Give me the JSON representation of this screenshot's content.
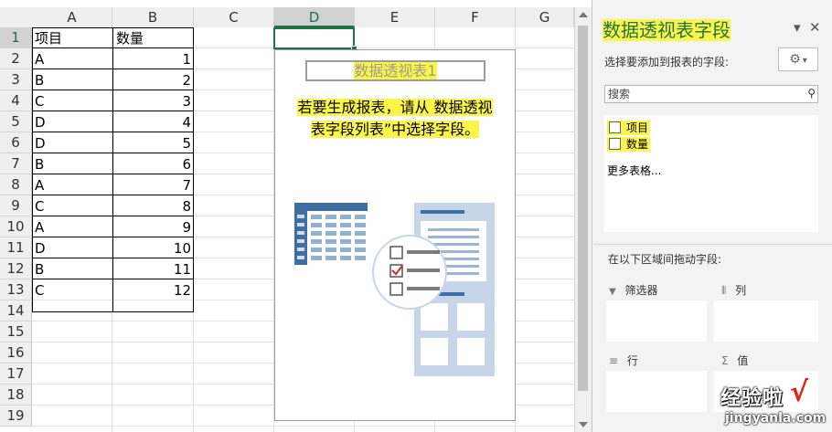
{
  "columns": [
    "A",
    "B",
    "C",
    "D",
    "E",
    "F",
    "G"
  ],
  "rows": [
    "1",
    "2",
    "3",
    "4",
    "5",
    "6",
    "7",
    "8",
    "9",
    "10",
    "11",
    "12",
    "13",
    "14",
    "15",
    "16",
    "17",
    "18",
    "19"
  ],
  "table": {
    "headers": [
      "项目",
      "数量"
    ],
    "data": [
      [
        "A",
        "1"
      ],
      [
        "B",
        "2"
      ],
      [
        "C",
        "3"
      ],
      [
        "D",
        "4"
      ],
      [
        "D",
        "5"
      ],
      [
        "B",
        "6"
      ],
      [
        "A",
        "7"
      ],
      [
        "C",
        "8"
      ],
      [
        "A",
        "9"
      ],
      [
        "D",
        "10"
      ],
      [
        "B",
        "11"
      ],
      [
        "C",
        "12"
      ]
    ]
  },
  "pivot_placeholder": {
    "title": "数据透视表1",
    "instruction_line1": "若要生成报表，请从 数据透视",
    "instruction_line2": "表字段列表”中选择字段。"
  },
  "panel": {
    "title": "数据透视表字段",
    "dropdown_icon": "▾",
    "close_icon": "✕",
    "choose_label": "选择要添加到报表的字段:",
    "gear_icon": "⚙",
    "gear_dropdown": "▾",
    "search_placeholder": "搜索",
    "search_icon": "⚲",
    "fields": [
      "项目",
      "数量"
    ],
    "more_tables": "更多表格...",
    "drag_label": "在以下区域间拖动字段:",
    "areas": {
      "filters": "筛选器",
      "columns": "列",
      "rows": "行",
      "values": "值"
    },
    "area_icons": {
      "filters": "▼",
      "columns": "⦀",
      "rows": "≡",
      "values": "Σ"
    }
  },
  "watermark": {
    "text": "经验啦",
    "check": "√",
    "url": "jingyanla.com"
  },
  "colors": {
    "accent": "#217346",
    "highlight": "#fbf54a",
    "illustration": "#3f6fa2"
  }
}
